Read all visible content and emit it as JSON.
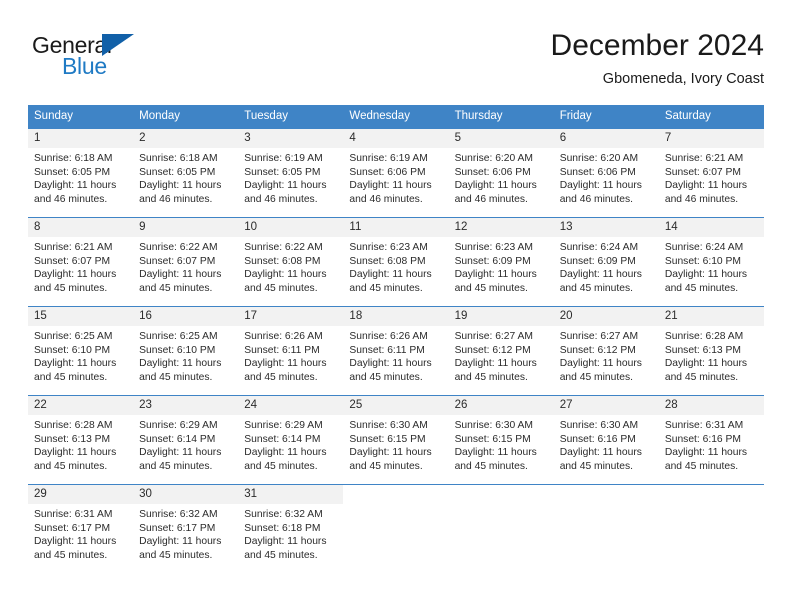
{
  "brand": {
    "name_part1": "General",
    "name_part2": "Blue",
    "triangle_color": "#1160a8",
    "blue_color": "#1f7ac4"
  },
  "header": {
    "title": "December 2024",
    "location": "Gbomeneda, Ivory Coast"
  },
  "theme": {
    "header_bg": "#3f84c6",
    "day_number_bg": "#f2f2f2",
    "text_color": "#2b2b2b"
  },
  "weekdays": [
    "Sunday",
    "Monday",
    "Tuesday",
    "Wednesday",
    "Thursday",
    "Friday",
    "Saturday"
  ],
  "weeks": [
    [
      {
        "day": "1",
        "sunrise": "Sunrise: 6:18 AM",
        "sunset": "Sunset: 6:05 PM",
        "daylight_line1": "Daylight: 11 hours",
        "daylight_line2": "and 46 minutes."
      },
      {
        "day": "2",
        "sunrise": "Sunrise: 6:18 AM",
        "sunset": "Sunset: 6:05 PM",
        "daylight_line1": "Daylight: 11 hours",
        "daylight_line2": "and 46 minutes."
      },
      {
        "day": "3",
        "sunrise": "Sunrise: 6:19 AM",
        "sunset": "Sunset: 6:05 PM",
        "daylight_line1": "Daylight: 11 hours",
        "daylight_line2": "and 46 minutes."
      },
      {
        "day": "4",
        "sunrise": "Sunrise: 6:19 AM",
        "sunset": "Sunset: 6:06 PM",
        "daylight_line1": "Daylight: 11 hours",
        "daylight_line2": "and 46 minutes."
      },
      {
        "day": "5",
        "sunrise": "Sunrise: 6:20 AM",
        "sunset": "Sunset: 6:06 PM",
        "daylight_line1": "Daylight: 11 hours",
        "daylight_line2": "and 46 minutes."
      },
      {
        "day": "6",
        "sunrise": "Sunrise: 6:20 AM",
        "sunset": "Sunset: 6:06 PM",
        "daylight_line1": "Daylight: 11 hours",
        "daylight_line2": "and 46 minutes."
      },
      {
        "day": "7",
        "sunrise": "Sunrise: 6:21 AM",
        "sunset": "Sunset: 6:07 PM",
        "daylight_line1": "Daylight: 11 hours",
        "daylight_line2": "and 46 minutes."
      }
    ],
    [
      {
        "day": "8",
        "sunrise": "Sunrise: 6:21 AM",
        "sunset": "Sunset: 6:07 PM",
        "daylight_line1": "Daylight: 11 hours",
        "daylight_line2": "and 45 minutes."
      },
      {
        "day": "9",
        "sunrise": "Sunrise: 6:22 AM",
        "sunset": "Sunset: 6:07 PM",
        "daylight_line1": "Daylight: 11 hours",
        "daylight_line2": "and 45 minutes."
      },
      {
        "day": "10",
        "sunrise": "Sunrise: 6:22 AM",
        "sunset": "Sunset: 6:08 PM",
        "daylight_line1": "Daylight: 11 hours",
        "daylight_line2": "and 45 minutes."
      },
      {
        "day": "11",
        "sunrise": "Sunrise: 6:23 AM",
        "sunset": "Sunset: 6:08 PM",
        "daylight_line1": "Daylight: 11 hours",
        "daylight_line2": "and 45 minutes."
      },
      {
        "day": "12",
        "sunrise": "Sunrise: 6:23 AM",
        "sunset": "Sunset: 6:09 PM",
        "daylight_line1": "Daylight: 11 hours",
        "daylight_line2": "and 45 minutes."
      },
      {
        "day": "13",
        "sunrise": "Sunrise: 6:24 AM",
        "sunset": "Sunset: 6:09 PM",
        "daylight_line1": "Daylight: 11 hours",
        "daylight_line2": "and 45 minutes."
      },
      {
        "day": "14",
        "sunrise": "Sunrise: 6:24 AM",
        "sunset": "Sunset: 6:10 PM",
        "daylight_line1": "Daylight: 11 hours",
        "daylight_line2": "and 45 minutes."
      }
    ],
    [
      {
        "day": "15",
        "sunrise": "Sunrise: 6:25 AM",
        "sunset": "Sunset: 6:10 PM",
        "daylight_line1": "Daylight: 11 hours",
        "daylight_line2": "and 45 minutes."
      },
      {
        "day": "16",
        "sunrise": "Sunrise: 6:25 AM",
        "sunset": "Sunset: 6:10 PM",
        "daylight_line1": "Daylight: 11 hours",
        "daylight_line2": "and 45 minutes."
      },
      {
        "day": "17",
        "sunrise": "Sunrise: 6:26 AM",
        "sunset": "Sunset: 6:11 PM",
        "daylight_line1": "Daylight: 11 hours",
        "daylight_line2": "and 45 minutes."
      },
      {
        "day": "18",
        "sunrise": "Sunrise: 6:26 AM",
        "sunset": "Sunset: 6:11 PM",
        "daylight_line1": "Daylight: 11 hours",
        "daylight_line2": "and 45 minutes."
      },
      {
        "day": "19",
        "sunrise": "Sunrise: 6:27 AM",
        "sunset": "Sunset: 6:12 PM",
        "daylight_line1": "Daylight: 11 hours",
        "daylight_line2": "and 45 minutes."
      },
      {
        "day": "20",
        "sunrise": "Sunrise: 6:27 AM",
        "sunset": "Sunset: 6:12 PM",
        "daylight_line1": "Daylight: 11 hours",
        "daylight_line2": "and 45 minutes."
      },
      {
        "day": "21",
        "sunrise": "Sunrise: 6:28 AM",
        "sunset": "Sunset: 6:13 PM",
        "daylight_line1": "Daylight: 11 hours",
        "daylight_line2": "and 45 minutes."
      }
    ],
    [
      {
        "day": "22",
        "sunrise": "Sunrise: 6:28 AM",
        "sunset": "Sunset: 6:13 PM",
        "daylight_line1": "Daylight: 11 hours",
        "daylight_line2": "and 45 minutes."
      },
      {
        "day": "23",
        "sunrise": "Sunrise: 6:29 AM",
        "sunset": "Sunset: 6:14 PM",
        "daylight_line1": "Daylight: 11 hours",
        "daylight_line2": "and 45 minutes."
      },
      {
        "day": "24",
        "sunrise": "Sunrise: 6:29 AM",
        "sunset": "Sunset: 6:14 PM",
        "daylight_line1": "Daylight: 11 hours",
        "daylight_line2": "and 45 minutes."
      },
      {
        "day": "25",
        "sunrise": "Sunrise: 6:30 AM",
        "sunset": "Sunset: 6:15 PM",
        "daylight_line1": "Daylight: 11 hours",
        "daylight_line2": "and 45 minutes."
      },
      {
        "day": "26",
        "sunrise": "Sunrise: 6:30 AM",
        "sunset": "Sunset: 6:15 PM",
        "daylight_line1": "Daylight: 11 hours",
        "daylight_line2": "and 45 minutes."
      },
      {
        "day": "27",
        "sunrise": "Sunrise: 6:30 AM",
        "sunset": "Sunset: 6:16 PM",
        "daylight_line1": "Daylight: 11 hours",
        "daylight_line2": "and 45 minutes."
      },
      {
        "day": "28",
        "sunrise": "Sunrise: 6:31 AM",
        "sunset": "Sunset: 6:16 PM",
        "daylight_line1": "Daylight: 11 hours",
        "daylight_line2": "and 45 minutes."
      }
    ],
    [
      {
        "day": "29",
        "sunrise": "Sunrise: 6:31 AM",
        "sunset": "Sunset: 6:17 PM",
        "daylight_line1": "Daylight: 11 hours",
        "daylight_line2": "and 45 minutes."
      },
      {
        "day": "30",
        "sunrise": "Sunrise: 6:32 AM",
        "sunset": "Sunset: 6:17 PM",
        "daylight_line1": "Daylight: 11 hours",
        "daylight_line2": "and 45 minutes."
      },
      {
        "day": "31",
        "sunrise": "Sunrise: 6:32 AM",
        "sunset": "Sunset: 6:18 PM",
        "daylight_line1": "Daylight: 11 hours",
        "daylight_line2": "and 45 minutes."
      },
      {
        "day": "",
        "sunrise": "",
        "sunset": "",
        "daylight_line1": "",
        "daylight_line2": ""
      },
      {
        "day": "",
        "sunrise": "",
        "sunset": "",
        "daylight_line1": "",
        "daylight_line2": ""
      },
      {
        "day": "",
        "sunrise": "",
        "sunset": "",
        "daylight_line1": "",
        "daylight_line2": ""
      },
      {
        "day": "",
        "sunrise": "",
        "sunset": "",
        "daylight_line1": "",
        "daylight_line2": ""
      }
    ]
  ]
}
